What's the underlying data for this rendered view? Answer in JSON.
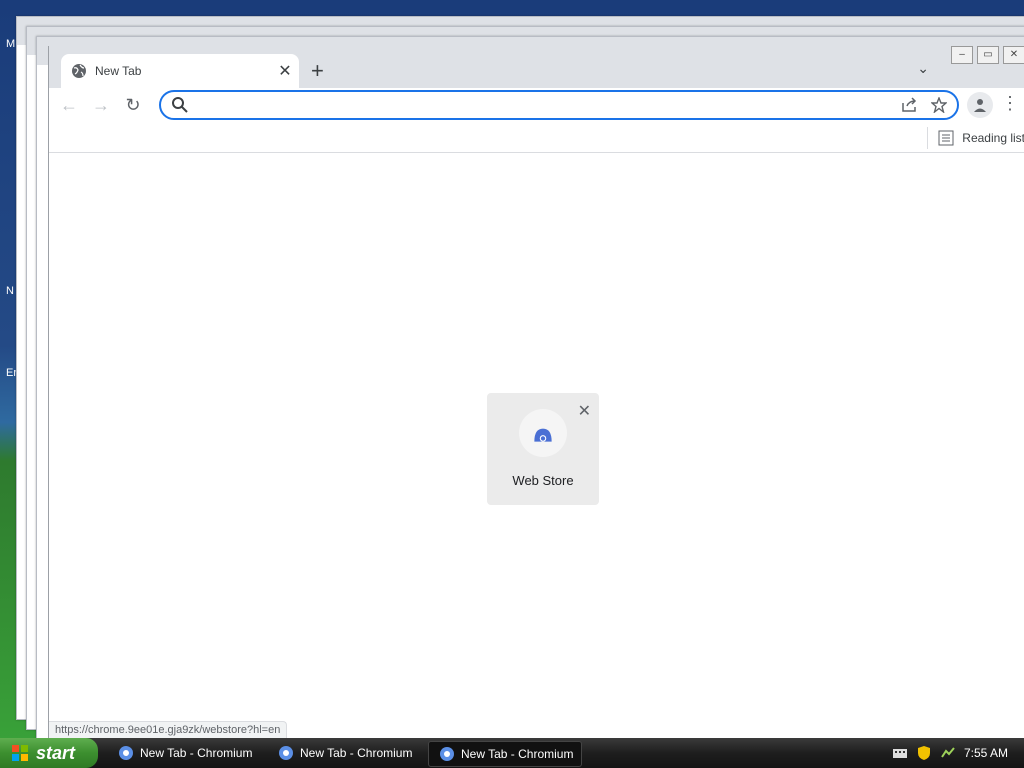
{
  "desktop": {
    "icon_labels": [
      "M",
      "N",
      "Er"
    ]
  },
  "browser": {
    "tab": {
      "title": "New Tab"
    },
    "omnibox": {
      "value": "",
      "placeholder": ""
    },
    "bookmarks_bar": {
      "reading_list_label": "Reading list"
    },
    "ntp": {
      "shortcut": {
        "label": "Web Store"
      },
      "status_url": "https://chrome.9ee01e.gja9zk/webstore?hl=en"
    }
  },
  "taskbar": {
    "start_label": "start",
    "buttons": [
      {
        "label": "New Tab - Chromium"
      },
      {
        "label": "New Tab - Chromium"
      },
      {
        "label": "New Tab - Chromium"
      }
    ],
    "clock": "7:55 AM"
  },
  "colors": {
    "accent": "#1a73e8",
    "tabstrip": "#dee1e6",
    "taskbar": "#1e1e1e",
    "start_green": "#3c8f2f"
  }
}
